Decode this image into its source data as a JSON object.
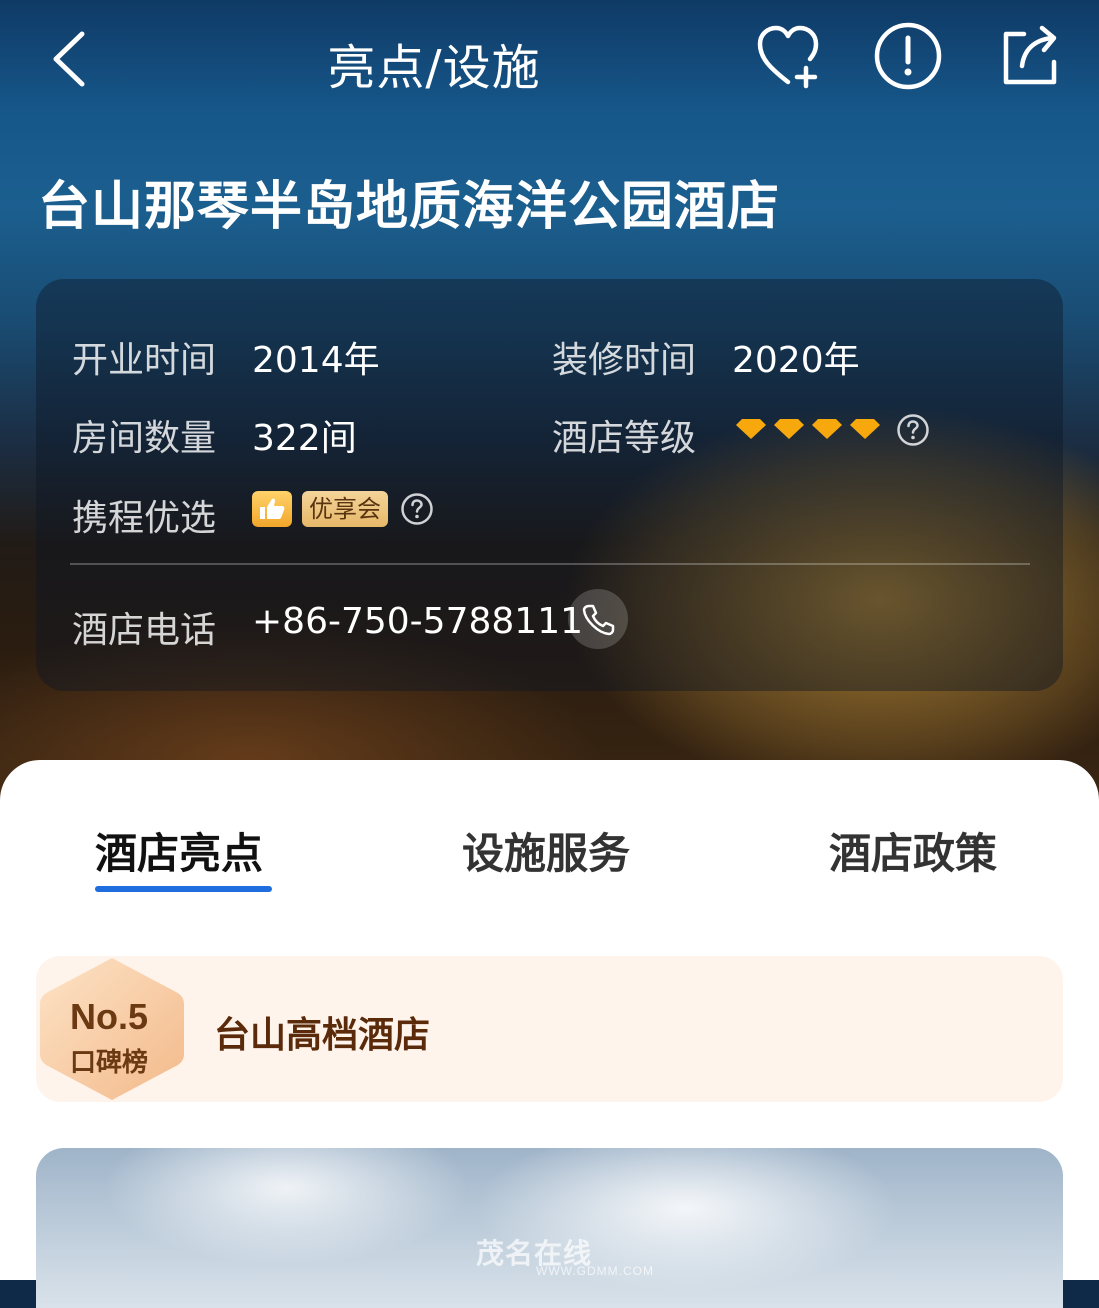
{
  "header": {
    "title": "亮点/设施",
    "back_icon": "chevron-left-icon",
    "favorite_icon": "heart-plus-icon",
    "report_icon": "exclamation-circle-icon",
    "share_icon": "share-icon"
  },
  "hotel": {
    "name": "台山那琴半岛地质海洋公园酒店"
  },
  "info": {
    "opened_label": "开业时间",
    "opened_value": "2014年",
    "renovated_label": "装修时间",
    "renovated_value": "2020年",
    "rooms_label": "房间数量",
    "rooms_value": "322间",
    "grade_label": "酒店等级",
    "grade_diamonds": 4,
    "selection_label": "携程优选",
    "vip_badge": "优享会",
    "phone_label": "酒店电话",
    "phone_value": "+86-750-5788111",
    "colors": {
      "diamond": "#f7a80c",
      "badge": "#e6b868"
    }
  },
  "tabs": [
    {
      "label": "酒店亮点",
      "active": true
    },
    {
      "label": "设施服务",
      "active": false
    },
    {
      "label": "酒店政策",
      "active": false
    }
  ],
  "ranking": {
    "number": "No.5",
    "list_name": "口碑榜",
    "title": "台山高档酒店"
  },
  "watermark": {
    "text": "茂名在线",
    "url": "WWW.GDMM.COM"
  },
  "accent_color": "#1f6ddf"
}
